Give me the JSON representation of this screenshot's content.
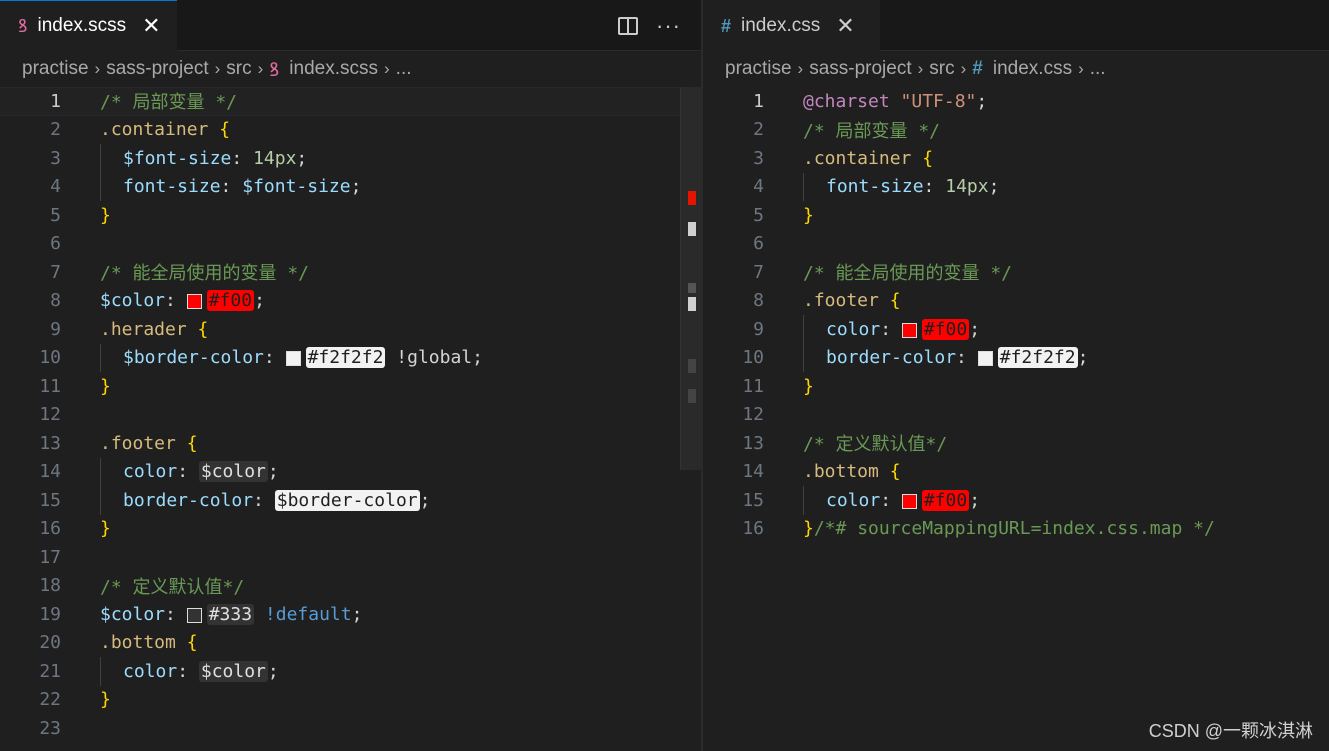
{
  "left": {
    "tab": {
      "icon": "sass-icon",
      "label": "index.scss",
      "close": "✕"
    },
    "breadcrumb": [
      "practise",
      "sass-project",
      "src",
      "index.scss",
      "..."
    ],
    "lines": [
      {
        "n": "1"
      },
      {
        "n": "2"
      },
      {
        "n": "3"
      },
      {
        "n": "4"
      },
      {
        "n": "5"
      },
      {
        "n": "6"
      },
      {
        "n": "7"
      },
      {
        "n": "8"
      },
      {
        "n": "9"
      },
      {
        "n": "10"
      },
      {
        "n": "11"
      },
      {
        "n": "12"
      },
      {
        "n": "13"
      },
      {
        "n": "14"
      },
      {
        "n": "15"
      },
      {
        "n": "16"
      },
      {
        "n": "17"
      },
      {
        "n": "18"
      },
      {
        "n": "19"
      },
      {
        "n": "20"
      },
      {
        "n": "21"
      },
      {
        "n": "22"
      },
      {
        "n": "23"
      }
    ],
    "code": {
      "l1": "/* 局部变量 */",
      "l2_sel": ".container",
      "brace_open": " {",
      "brace_close": "}",
      "l3_var": "$font-size",
      "colon": ": ",
      "l3_val": "14px",
      "semi": ";",
      "l4_prop": "font-size",
      "l4_val": "$font-size",
      "l7": "/* 能全局使用的变量 */",
      "l8_var": "$color",
      "l8_val": "#f00",
      "l9_sel": ".herader",
      "l10_var": "$border-color",
      "l10_val": "#f2f2f2",
      "l10_flag": " !global",
      "l13_sel": ".footer",
      "l14_prop": "color",
      "l14_val": "$color",
      "l15_prop": "border-color",
      "l15_val": "$border-color",
      "l18": "/* 定义默认值*/",
      "l19_var": "$color",
      "l19_val": "#333",
      "l19_flag": " !default",
      "l20_sel": ".bottom",
      "l21_prop": "color",
      "l21_val": "$color"
    }
  },
  "right": {
    "tab": {
      "icon": "#",
      "label": "index.css",
      "close": "✕"
    },
    "breadcrumb": [
      "practise",
      "sass-project",
      "src",
      "index.css",
      "..."
    ],
    "lines": [
      {
        "n": "1"
      },
      {
        "n": "2"
      },
      {
        "n": "3"
      },
      {
        "n": "4"
      },
      {
        "n": "5"
      },
      {
        "n": "6"
      },
      {
        "n": "7"
      },
      {
        "n": "8"
      },
      {
        "n": "9"
      },
      {
        "n": "10"
      },
      {
        "n": "11"
      },
      {
        "n": "12"
      },
      {
        "n": "13"
      },
      {
        "n": "14"
      },
      {
        "n": "15"
      },
      {
        "n": "16"
      }
    ],
    "code": {
      "l1_at": "@charset",
      "l1_str": " \"UTF-8\"",
      "semi": ";",
      "l2": "/* 局部变量 */",
      "l3_sel": ".container",
      "brace_open": " {",
      "brace_close": "}",
      "colon": ": ",
      "l4_prop": "font-size",
      "l4_val": "14px",
      "l7": "/* 能全局使用的变量 */",
      "l8_sel": ".footer",
      "l9_prop": "color",
      "l9_val": "#f00",
      "l10_prop": "border-color",
      "l10_val": "#f2f2f2",
      "l13": "/* 定义默认值*/",
      "l14_sel": ".bottom",
      "l15_prop": "color",
      "l15_val": "#f00",
      "l16_cmt": "/*# sourceMappingURL=index.css.map */"
    }
  },
  "watermark": "CSDN @一颗冰淇淋",
  "colors": {
    "accent": "#0078d4",
    "red": "#ff0000",
    "light": "#f2f2f2",
    "dark": "#333333"
  }
}
